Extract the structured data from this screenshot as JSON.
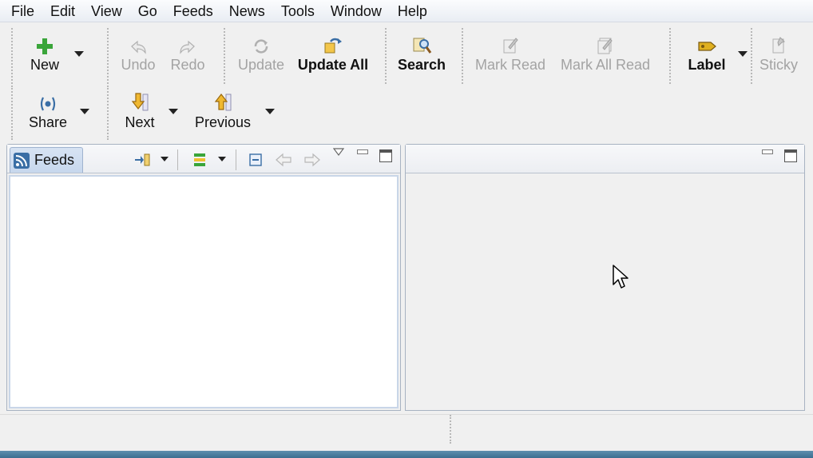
{
  "menubar": {
    "items": [
      "File",
      "Edit",
      "View",
      "Go",
      "Feeds",
      "News",
      "Tools",
      "Window",
      "Help"
    ]
  },
  "toolbar": {
    "new": "New",
    "undo": "Undo",
    "redo": "Redo",
    "update": "Update",
    "update_all": "Update All",
    "search": "Search",
    "mark_read": "Mark Read",
    "mark_all_read": "Mark All Read",
    "label": "Label",
    "sticky": "Sticky",
    "share": "Share",
    "next": "Next",
    "previous": "Previous"
  },
  "feeds_panel": {
    "tab_label": "Feeds"
  },
  "colors": {
    "disabled_text": "#a3a3a3",
    "accent_blue": "#3a6ea5",
    "new_green": "#3aa53a",
    "label_yellow": "#e0b020"
  }
}
